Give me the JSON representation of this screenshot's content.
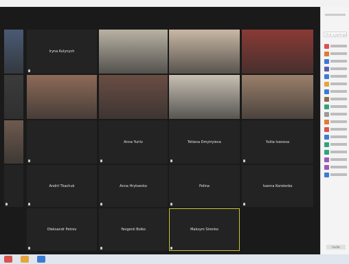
{
  "meeting": {
    "tiles": [
      {
        "id": "r1c1",
        "name": "",
        "caption": "",
        "type": "video"
      },
      {
        "id": "r1c2",
        "name": "Iryna Kulynych",
        "caption": "",
        "type": "name"
      },
      {
        "id": "r1c3",
        "name": "",
        "caption": "",
        "type": "video"
      },
      {
        "id": "r1c4",
        "name": "",
        "caption": "",
        "type": "video"
      },
      {
        "id": "r1c5",
        "name": "",
        "caption": "",
        "type": "video"
      },
      {
        "id": "r2c1",
        "name": "",
        "caption": "",
        "type": "video"
      },
      {
        "id": "r2c2",
        "name": "",
        "caption": "",
        "type": "video"
      },
      {
        "id": "r2c3",
        "name": "",
        "caption": "",
        "type": "video"
      },
      {
        "id": "r2c4",
        "name": "",
        "caption": "",
        "type": "video"
      },
      {
        "id": "r2c5",
        "name": "",
        "caption": "",
        "type": "video"
      },
      {
        "id": "r3c1",
        "name": "",
        "caption": "",
        "type": "video"
      },
      {
        "id": "r3c2",
        "name": "",
        "caption": "",
        "type": "name"
      },
      {
        "id": "r3c3",
        "name": "Anna Yuriiv",
        "caption": "",
        "type": "name"
      },
      {
        "id": "r3c4",
        "name": "Tetiana Dmytryieva",
        "caption": "",
        "type": "name"
      },
      {
        "id": "r3c5",
        "name": "Yuliia Ivanova",
        "caption": "",
        "type": "name"
      },
      {
        "id": "r4c1",
        "name": "",
        "caption": "",
        "type": "name"
      },
      {
        "id": "r4c2",
        "name": "Andrii Tkachuk",
        "caption": "",
        "type": "name"
      },
      {
        "id": "r4c3",
        "name": "Anna Hrytsenko",
        "caption": "",
        "type": "name"
      },
      {
        "id": "r4c4",
        "name": "Polina",
        "caption": "",
        "type": "name"
      },
      {
        "id": "r4c5",
        "name": "Ivanna Korolenko",
        "caption": "",
        "type": "name"
      },
      {
        "id": "r5c2",
        "name": "Oleksandr Petrov",
        "caption": "",
        "type": "name"
      },
      {
        "id": "r5c3",
        "name": "Yevgenii Boiko",
        "caption": "",
        "type": "name"
      },
      {
        "id": "r5c4",
        "name": "Maksym Sirenko",
        "caption": "",
        "type": "name",
        "active": true
      }
    ]
  },
  "sidebar": {
    "search_placeholder": "Find a participant",
    "participants_colors": [
      "#d9534f",
      "#e07b39",
      "#3b7bd3",
      "#5b5bb5",
      "#3b7bd3",
      "#e5a53a",
      "#3b7bd3",
      "#8a6a4a",
      "#31a37a",
      "#9a9a9a",
      "#e07b39",
      "#d9534f",
      "#3b7bd3",
      "#31a37a",
      "#31a37a",
      "#9b59b6",
      "#9b59b6",
      "#3b7bd3"
    ],
    "invite": "Invite"
  },
  "taskbar": {
    "icons": [
      {
        "name": "windows-icon",
        "color": "#d9534f"
      },
      {
        "name": "chrome-icon",
        "color": "#e5a53a"
      },
      {
        "name": "zoom-icon",
        "color": "#3b7bd3"
      }
    ]
  }
}
